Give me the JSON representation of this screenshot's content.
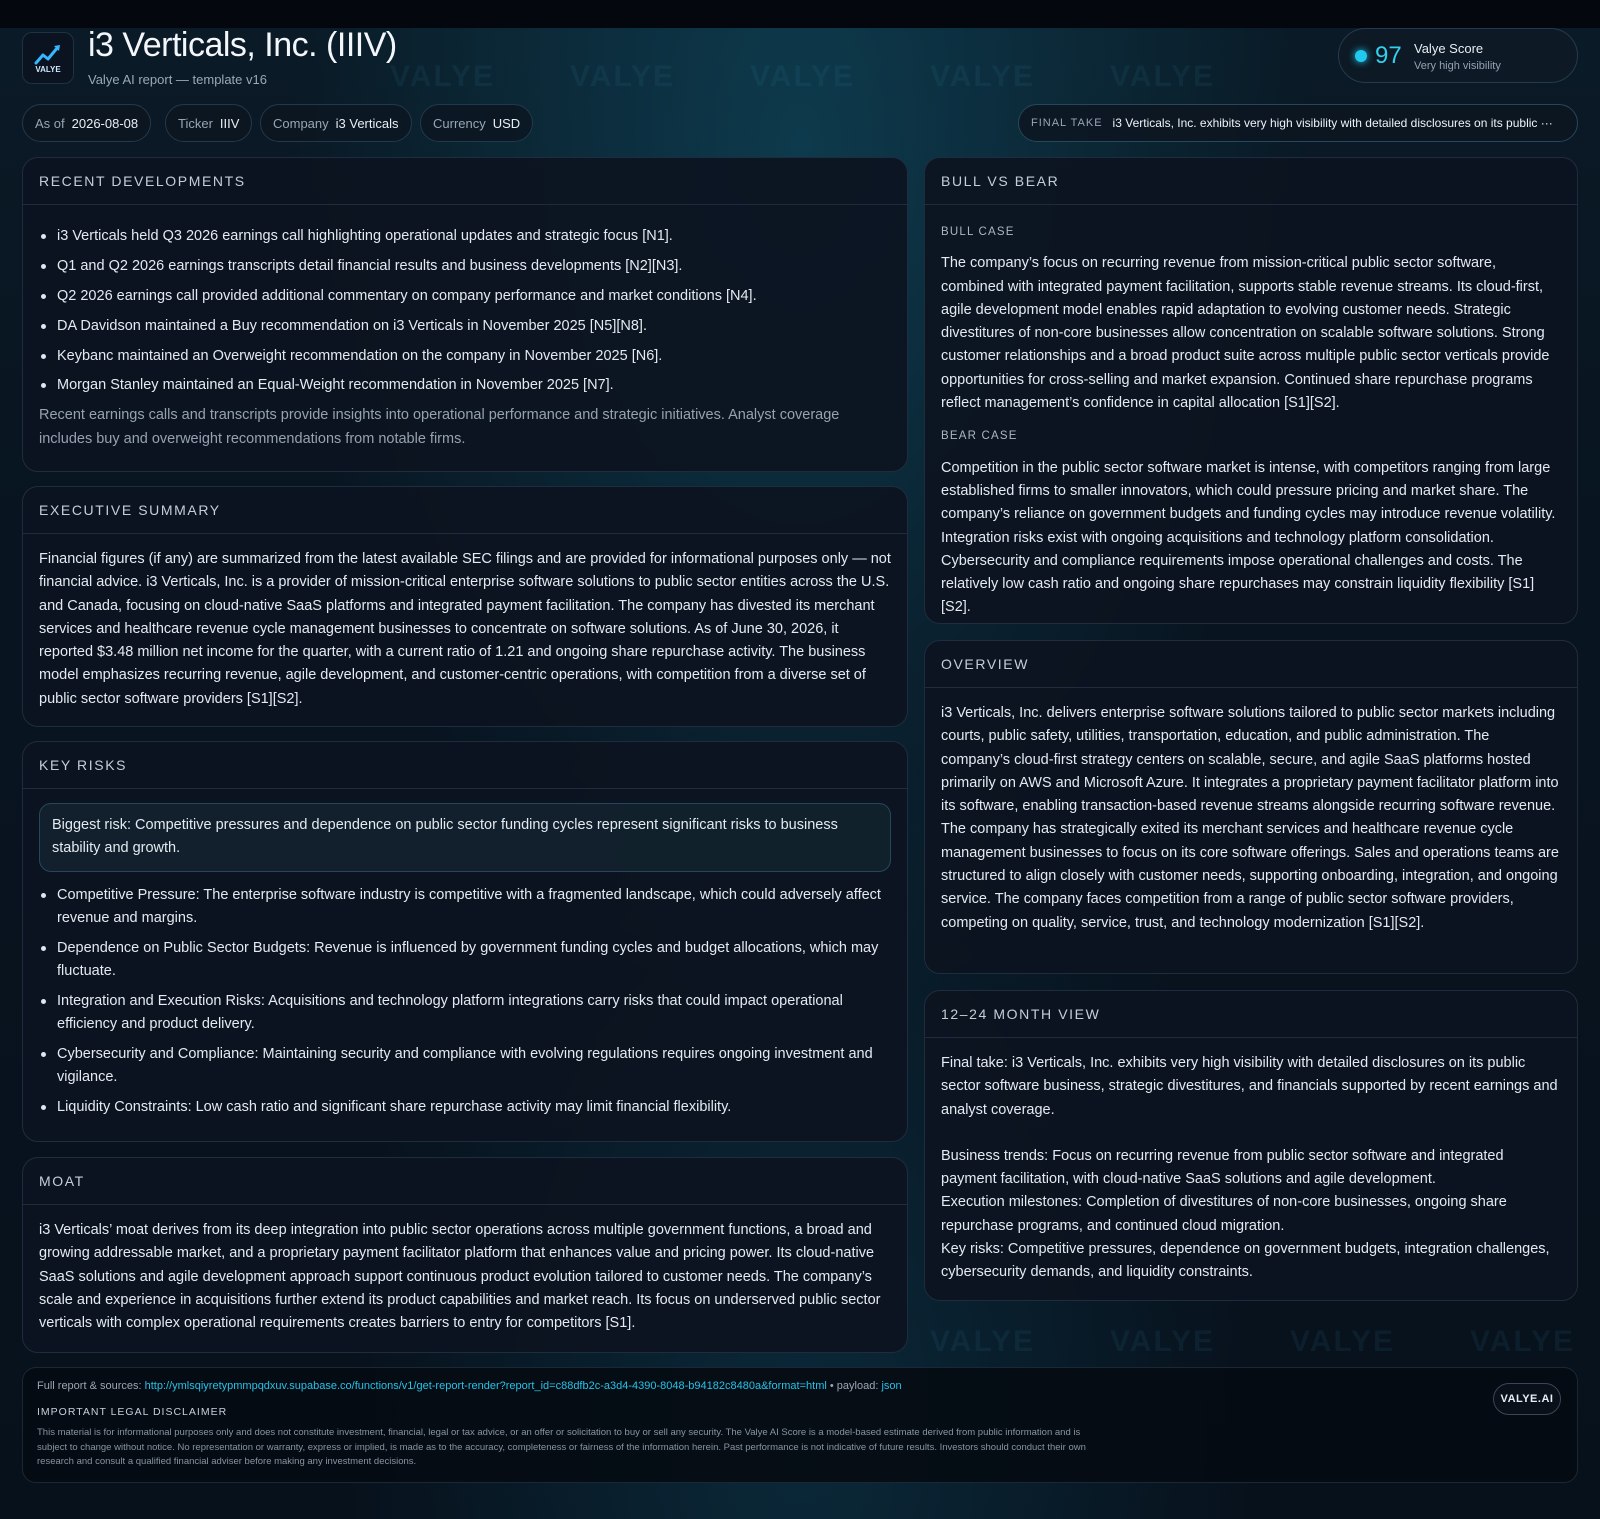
{
  "header": {
    "logo_text": "VALYE",
    "title": "i3 Verticals, Inc. (IIIV)",
    "subtitle": "Valye AI report — template v16",
    "score": {
      "value": "97",
      "label": "Valye Score",
      "sub": "Very high visibility",
      "accent": "#22c9ee"
    }
  },
  "watermark": "VALYE",
  "chips": [
    {
      "key": "As of",
      "value": "2026-08-08"
    },
    {
      "key": "Ticker",
      "value": "IIIV"
    },
    {
      "key": "Company",
      "value": "i3 Verticals"
    },
    {
      "key": "Currency",
      "value": "USD"
    }
  ],
  "final_take": {
    "key": "FINAL TAKE",
    "value": "i3 Verticals, Inc. exhibits very high visibility with detailed disclosures on its public ···"
  },
  "recent": {
    "title": "RECENT DEVELOPMENTS",
    "items": [
      "i3 Verticals held Q3 2026 earnings call highlighting operational updates and strategic focus [N1].",
      "Q1 and Q2 2026 earnings transcripts detail financial results and business developments [N2][N3].",
      "Q2 2026 earnings call provided additional commentary on company performance and market conditions [N4].",
      "DA Davidson maintained a Buy recommendation on i3 Verticals in November 2025 [N5][N8].",
      "Keybanc maintained an Overweight recommendation on the company in November 2025 [N6].",
      "Morgan Stanley maintained an Equal-Weight recommendation in November 2025 [N7]."
    ],
    "note": "Recent earnings calls and transcripts provide insights into operational performance and strategic initiatives. Analyst coverage includes buy and overweight recommendations from notable firms."
  },
  "exec": {
    "title": "EXECUTIVE SUMMARY",
    "body": "Financial figures (if any) are summarized from the latest available SEC filings and are provided for informational purposes only — not financial advice. i3 Verticals, Inc. is a provider of mission-critical enterprise software solutions to public sector entities across the U.S. and Canada, focusing on cloud-native SaaS platforms and integrated payment facilitation. The company has divested its merchant services and healthcare revenue cycle management businesses to concentrate on software solutions. As of June 30, 2026, it reported $3.48 million net income for the quarter, with a current ratio of 1.21 and ongoing share repurchase activity. The business model emphasizes recurring revenue, agile development, and customer-centric operations, with competition from a diverse set of public sector software providers [S1][S2]."
  },
  "risks": {
    "title": "KEY RISKS",
    "biggest": "Biggest risk: Competitive pressures and dependence on public sector funding cycles represent significant risks to business stability and growth.",
    "items": [
      "Competitive Pressure: The enterprise software industry is competitive with a fragmented landscape, which could adversely affect revenue and margins.",
      "Dependence on Public Sector Budgets: Revenue is influenced by government funding cycles and budget allocations, which may fluctuate.",
      "Integration and Execution Risks: Acquisitions and technology platform integrations carry risks that could impact operational efficiency and product delivery.",
      "Cybersecurity and Compliance: Maintaining security and compliance with evolving regulations requires ongoing investment and vigilance.",
      "Liquidity Constraints: Low cash ratio and significant share repurchase activity may limit financial flexibility."
    ]
  },
  "moat": {
    "title": "MOAT",
    "body": "i3 Verticals’ moat derives from its deep integration into public sector operations across multiple government functions, a broad and growing addressable market, and a proprietary payment facilitator platform that enhances value and pricing power. Its cloud-native SaaS solutions and agile development approach support continuous product evolution tailored to customer needs. The company’s scale and experience in acquisitions further extend its product capabilities and market reach. Its focus on underserved public sector verticals with complex operational requirements creates barriers to entry for competitors [S1]."
  },
  "bullbear": {
    "title": "BULL VS BEAR",
    "bull_label": "BULL CASE",
    "bull": "The company’s focus on recurring revenue from mission-critical public sector software, combined with integrated payment facilitation, supports stable revenue streams. Its cloud-first, agile development model enables rapid adaptation to evolving customer needs. Strategic divestitures of non-core businesses allow concentration on scalable software solutions. Strong customer relationships and a broad product suite across multiple public sector verticals provide opportunities for cross-selling and market expansion. Continued share repurchase programs reflect management’s confidence in capital allocation [S1][S2].",
    "bear_label": "BEAR CASE",
    "bear": "Competition in the public sector software market is intense, with competitors ranging from large established firms to smaller innovators, which could pressure pricing and market share. The company’s reliance on government budgets and funding cycles may introduce revenue volatility. Integration risks exist with ongoing acquisitions and technology platform consolidation. Cybersecurity and compliance requirements impose operational challenges and costs. The relatively low cash ratio and ongoing share repurchases may constrain liquidity flexibility [S1][S2]."
  },
  "overview": {
    "title": "OVERVIEW",
    "body": "i3 Verticals, Inc. delivers enterprise software solutions tailored to public sector markets including courts, public safety, utilities, transportation, education, and public administration. The company’s cloud-first strategy centers on scalable, secure, and agile SaaS platforms hosted primarily on AWS and Microsoft Azure. It integrates a proprietary payment facilitator platform into its software, enabling transaction-based revenue streams alongside recurring software revenue. The company has strategically exited its merchant services and healthcare revenue cycle management businesses to focus on its core software offerings. Sales and operations teams are structured to align closely with customer needs, supporting onboarding, integration, and ongoing service. The company faces competition from a range of public sector software providers, competing on quality, service, trust, and technology modernization [S1][S2]."
  },
  "view": {
    "title": "12–24 MONTH VIEW",
    "final": "Final take: i3 Verticals, Inc. exhibits very high visibility with detailed disclosures on its public sector software business, strategic divestitures, and financials supported by recent earnings and analyst coverage.",
    "trends": "Business trends: Focus on recurring revenue from public sector software and integrated payment facilitation, with cloud-native SaaS solutions and agile development.",
    "milestones": "Execution milestones: Completion of divestitures of non-core businesses, ongoing share repurchase programs, and continued cloud migration.",
    "risks": "Key risks: Competitive pressures, dependence on government budgets, integration challenges, cybersecurity demands, and liquidity constraints."
  },
  "footer": {
    "src_label": "Full report & sources:",
    "url": "http://ymlsqiyretypmmpqdxuv.supabase.co/functions/v1/get-report-render?report_id=c88dfb2c-a3d4-4390-8048-b94182c8480a&format=html",
    "payload_label": "• payload:",
    "payload_link": "json",
    "disclaimer_title": "IMPORTANT LEGAL DISCLAIMER",
    "disclaimer": "This material is for informational purposes only and does not constitute investment, financial, legal or tax advice, or an offer or solicitation to buy or sell any security. The Valye AI Score is a model-based estimate derived from public information and is subject to change without notice. No representation or warranty, express or implied, is made as to the accuracy, completeness or fairness of the information herein. Past performance is not indicative of future results. Investors should conduct their own research and consult a qualified financial adviser before making any investment decisions.",
    "brand": "VALYE.AI"
  }
}
